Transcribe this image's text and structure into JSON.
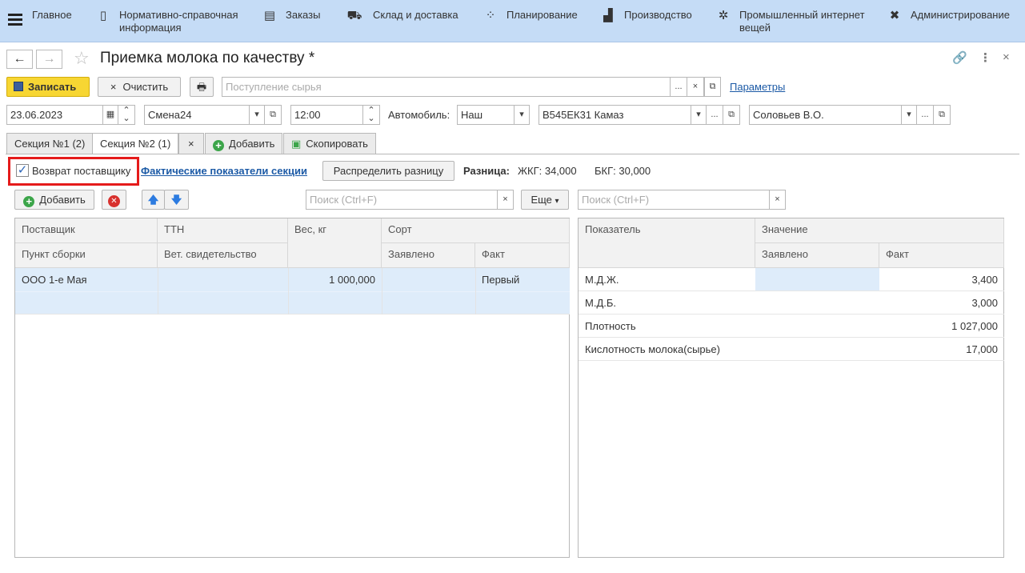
{
  "menu": [
    {
      "icon": "hamburger-icon",
      "label": ""
    },
    {
      "icon": "home-icon",
      "label": "Главное"
    },
    {
      "icon": "book-icon",
      "label": "Нормативно-справочная\nинформация"
    },
    {
      "icon": "orders-icon",
      "label": "Заказы"
    },
    {
      "icon": "truck-icon",
      "label": "Склад и доставка"
    },
    {
      "icon": "planning-icon",
      "label": "Планирование"
    },
    {
      "icon": "factory-icon",
      "label": "Производство"
    },
    {
      "icon": "iot-icon",
      "label": "Промышленный интернет\nвещей"
    },
    {
      "icon": "tools-icon",
      "label": "Администрирование"
    }
  ],
  "title": "Приемка молока по качеству *",
  "toolbar": {
    "save": "Записать",
    "clear": "Очистить",
    "source_placeholder": "Поступление сырья",
    "params": "Параметры"
  },
  "header": {
    "date": "23.06.2023",
    "shift": "Смена24",
    "time": "12:00",
    "car_label": "Автомобиль:",
    "car_type": "Наш",
    "car": "В545ЕК31 Камаз",
    "person": "Соловьев В.О."
  },
  "tabs": {
    "t1": "Секция №1 (2)",
    "t2": "Секция №2 (1)",
    "close": "×",
    "add": "Добавить",
    "copy": "Скопировать"
  },
  "section": {
    "return_label": "Возврат поставщику",
    "return_checked": true,
    "actual_link": "Фактические показатели секции",
    "distribute": "Распределить разницу",
    "diff_label": "Разница:",
    "zhkg": "ЖКГ: 34,000",
    "bkg": "БКГ: 30,000"
  },
  "left": {
    "add": "Добавить",
    "search_placeholder": "Поиск (Ctrl+F)",
    "more": "Еще",
    "headers": {
      "supplier": "Поставщик",
      "ttn": "ТТН",
      "weight": "Вес, кг",
      "grade": "Сорт",
      "point": "Пункт сборки",
      "vet": "Вет. свидетельство",
      "declared": "Заявлено",
      "fact": "Факт"
    },
    "rows": [
      {
        "supplier": "ООО 1-е Мая",
        "ttn": "",
        "weight": "1 000,000",
        "declared": "",
        "fact": "Первый"
      }
    ]
  },
  "right": {
    "search_placeholder": "Поиск (Ctrl+F)",
    "headers": {
      "indicator": "Показатель",
      "value": "Значение",
      "declared": "Заявлено",
      "fact": "Факт"
    },
    "rows": [
      {
        "indicator": "М.Д.Ж.",
        "declared": "",
        "fact": "3,400"
      },
      {
        "indicator": "М.Д.Б.",
        "declared": "",
        "fact": "3,000"
      },
      {
        "indicator": "Плотность",
        "declared": "",
        "fact": "1 027,000"
      },
      {
        "indicator": "Кислотность молока(сырье)",
        "declared": "",
        "fact": "17,000"
      }
    ]
  }
}
